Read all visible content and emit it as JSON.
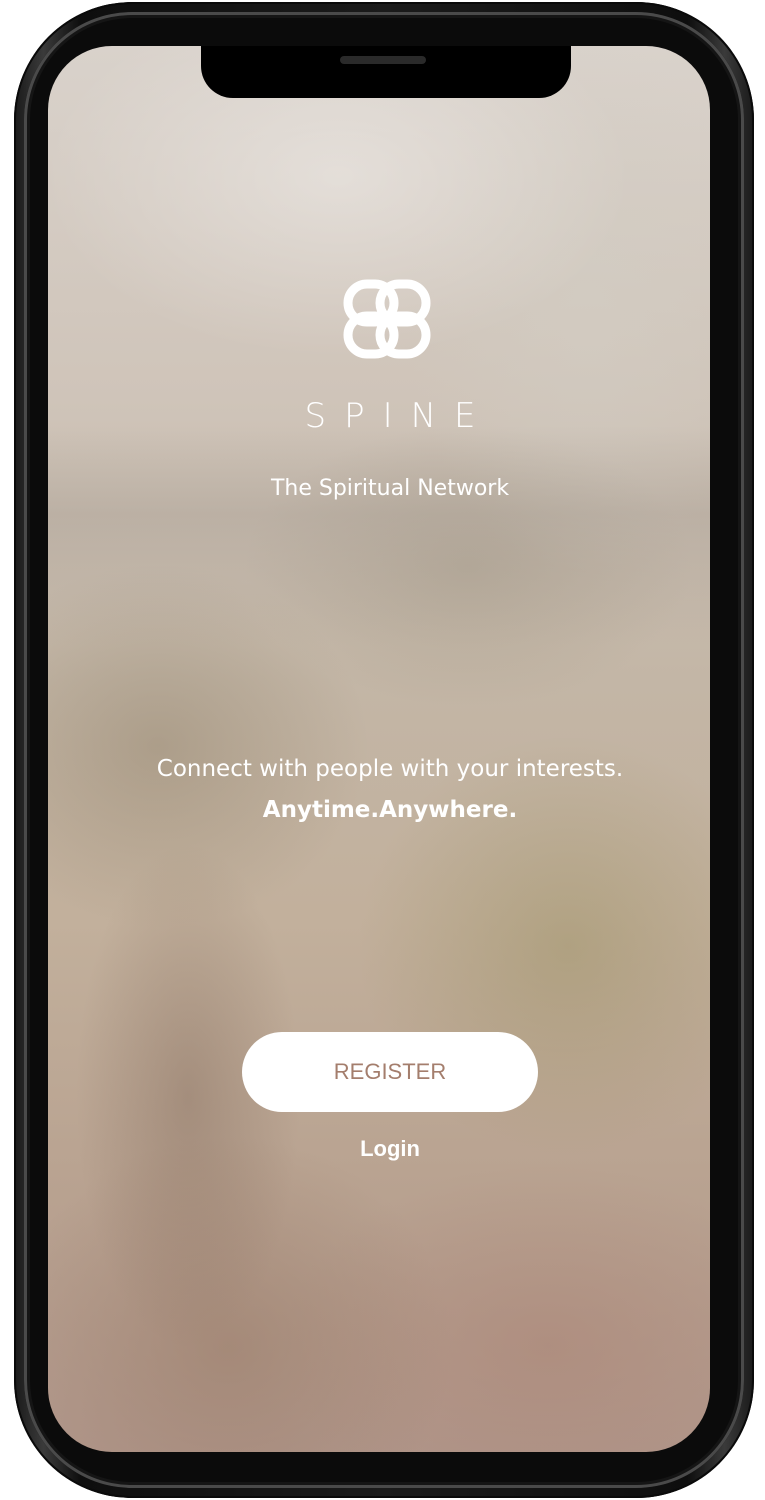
{
  "app": {
    "brand_name": "SPINE",
    "tagline": "The Spiritual Network",
    "logo_icon": "interlocking-loops-logo"
  },
  "intro": {
    "line1": "Connect with people with your interests.",
    "line2": "Anytime.Anywhere."
  },
  "actions": {
    "register_label": "REGISTER",
    "login_label": "Login"
  },
  "colors": {
    "button_text": "#a47e6d",
    "button_bg": "#ffffff",
    "text": "#ffffff"
  }
}
